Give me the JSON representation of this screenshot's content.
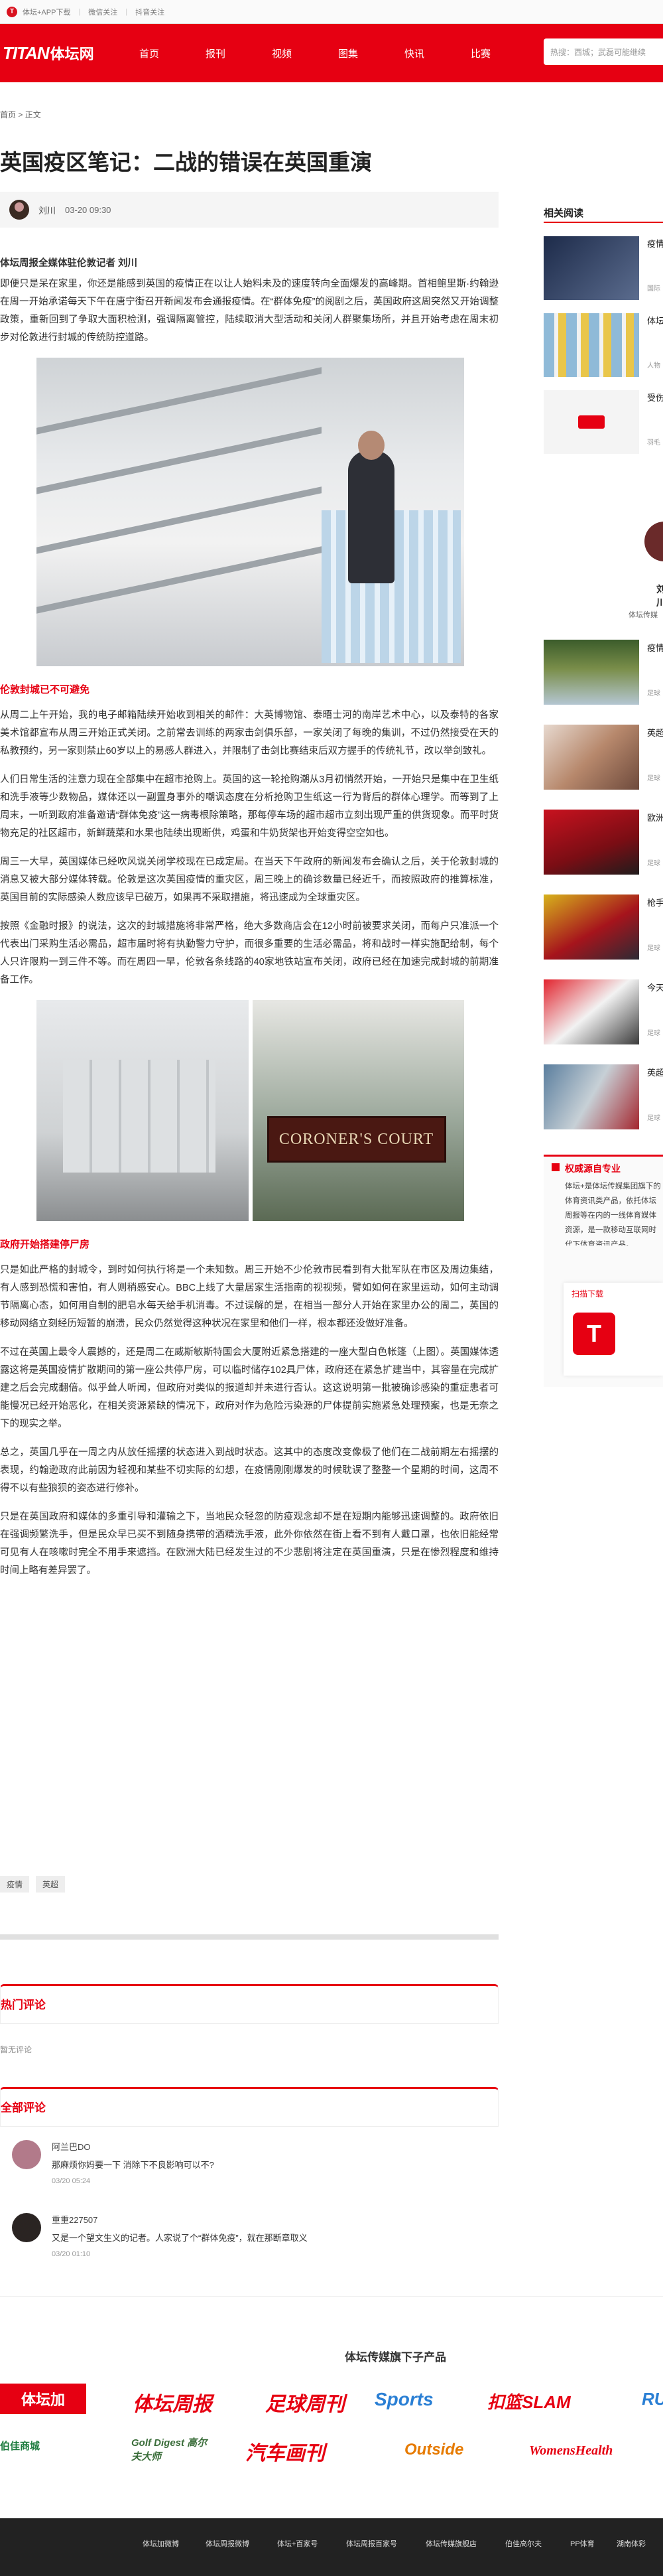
{
  "topbar": {
    "links": [
      "体坛+APP下载",
      "微信关注",
      "抖音关注"
    ]
  },
  "brand": {
    "logo_en": "TITAN",
    "logo_cn": "体坛网"
  },
  "nav": {
    "items": [
      "首页",
      "报刊",
      "视频",
      "图集",
      "快讯",
      "比赛"
    ],
    "search_placeholder": "热搜：西城；武磊可能继续"
  },
  "breadcrumb": {
    "home": "首页",
    "sep": ">",
    "current": "正文"
  },
  "article": {
    "title": "英国疫区笔记：二战的错误在英国重演",
    "author": "刘川",
    "date": "03-20 09:30",
    "lead": "体坛周报全媒体驻伦敦记者 刘川",
    "p1": "即便只是呆在家里，你还是能感到英国的疫情正在以让人始料未及的速度转向全面爆发的高峰期。首相鲍里斯·约翰逊在周一开始承诺每天下午在唐宁街召开新闻发布会通报疫情。在“群体免疫”的阅剧之后，英国政府这周突然又开始调整政策，重新回到了争取大面积检测，强调隔离管控，陆续取消大型活动和关闭人群聚集场所，并且开始考虑在周末初步对伦敦进行封城的传统防控道路。",
    "h1": "伦敦封城已不可避免",
    "p2": "从周二上午开始，我的电子邮箱陆续开始收到相关的邮件：大英博物馆、泰晤士河的南岸艺术中心，以及泰特的各家美术馆都宣布从周三开始正式关闭。之前常去训练的两家击剑俱乐部，一家关闭了每晚的集训，不过仍然接受在天的私教预约，另一家则禁止60岁以上的易感人群进入，并限制了击剑比赛结束后双方握手的传统礼节，改以举剑致礼。",
    "p3": "人们日常生活的注意力现在全部集中在超市抢购上。英国的这一轮抢购潮从3月初悄然开始，一开始只是集中在卫生纸和洗手液等少数物品，媒体还以一副置身事外的嘲讽态度在分析抢购卫生纸这一行为背后的群体心理学。而等到了上周末，一听到政府准备邀请“群体免疫”这一病毒根除策略，那每停车场的超市超市立刻出现严重的供货现象。而平时货物充足的社区超市，新鲜蔬菜和水果也陆续出现断供，鸡蛋和牛奶货架也开始变得空空如也。",
    "p4": "周三一大早，英国媒体已经吹风说关闭学校现在已成定局。在当天下午政府的新闻发布会确认之后，关于伦敦封城的消息又被大部分媒体转载。伦敦是这次英国疫情的重灾区，周三晚上的确诊数量已经近千，而按照政府的推算标准，英国目前的实际感染人数应该早已破万，如果再不采取措施，将迅速成为全球重灾区。",
    "p5": "按照《金融时报》的说法，这次的封城措施将非常严格，绝大多数商店会在12小时前被要求关闭，而每户只准派一个代表出门采购生活必需品，超市届时将有执勤警力守护，而很多重要的生活必需品，将和战时一样实施配给制，每个人只许限购一到三件不等。而在周四一早，伦敦各条线路的40家地铁站宣布关闭，政府已经在加速完成封城的前期准备工作。",
    "h2": "政府开始搭建停尸房",
    "p6": "只是如此严格的封城令，到时如何执行将是一个未知数。周三开始不少伦敦市民看到有大批军队在市区及周边集结，有人感到恐慌和害怕，有人则稍感安心。BBC上线了大量居家生活指南的视视频，譬如如何在家里运动，如何主动调节隔离心态，如何用自制的肥皂水每天给手机消毒。不过误解的是，在相当一部分人开始在家里办公的周二，英国的移动网络立刻经历短暂的崩溃，民众仍然觉得这种状况在家里和他们一样，根本都还没做好准备。",
    "p7": "不过在英国上最令人震撼的，还是周二在威斯敏斯特国会大厦附近紧急搭建的一座大型白色帐篷（上图）。英国媒体透露这将是英国疫情扩散期间的第一座公共停尸房，可以临时储存102具尸体，政府还在紧急扩建当中，其容量在完成扩建之后会完成翻倍。似乎耸人听闻，但政府对类似的报道却并未进行否认。这这说明第一批被确诊感染的重症患者可能慢况已经开始恶化，在相关资源紧缺的情况下，政府对作为危险污染源的尸体提前实施紧急处理预案，也是无奈之下的现实之举。",
    "p8": "总之，英国几乎在一周之内从放任摇摆的状态进入到战时状态。这其中的态度改变像极了他们在二战前期左右摇摆的表现，约翰逊政府此前因为轻视和某些不切实际的幻想，在疫情刚刚爆发的时候耽误了整整一个星期的时间，这周不得不以有些狼狈的姿态进行修补。",
    "p9": "只是在英国政府和媒体的多重引导和灌输之下，当地民众轻忽的防疫观念却不是在短期内能够迅速调整的。政府依旧在强调频繁洗手，但是民众早已买不到随身携带的酒精洗手液，此外你依然在街上看不到有人戴口罩，也依旧能经常可见有人在咳嗽时完全不用手来遮挡。在欧洲大陆已经发生过的不少悲剧将注定在英国重演，只是在惨烈程度和维持时间上略有差异罢了。",
    "img2_sign": "CORONER'S COURT"
  },
  "tags": [
    "疫情",
    "英超"
  ],
  "comments": {
    "hot_title": "热门评论",
    "hot_empty": "暂无评论",
    "all_title": "全部评论",
    "items": [
      {
        "user": "阿兰巴DO",
        "text": "那麻烦你妈要一下 消除下不良影响可以不?",
        "date": "03/20 05:24"
      },
      {
        "user": "重重227507",
        "text": "又是一个望文生义的记者。人家说了个“群体免疫”，就在那断章取义",
        "date": "03/20 01:10"
      }
    ]
  },
  "sidebar": {
    "related_title": "相关阅读",
    "related": [
      {
        "title": "疫情",
        "source": "国际"
      },
      {
        "title": "体坛",
        "source": "人物"
      },
      {
        "title": "受伤",
        "source": "羽毛"
      }
    ],
    "card_name": "刘川",
    "card_sub": "体坛传媒",
    "more": [
      {
        "title": "疫情",
        "source": "足球"
      },
      {
        "title": "英超",
        "source": "足球"
      },
      {
        "title": "欧洲",
        "source": "足球"
      },
      {
        "title": "枪手",
        "source": "足球"
      },
      {
        "title": "今天",
        "source": "足球"
      },
      {
        "title": "英超",
        "source": "足球"
      }
    ],
    "authority_title": "权威源自专业",
    "authority_body": "体坛+是体坛传媒集团旗下的体育资讯类产品，依托体坛周报等在内的一线体育媒体资源，是一款移动互联网时代下体育资讯产品。",
    "qr_label": "扫描下载",
    "qr_icon": "T"
  },
  "family": {
    "title": "体坛传媒旗下子产品",
    "logos": [
      "体坛加",
      "体坛周报",
      "足球周刊",
      "Sports",
      "扣篮SLAM",
      "RU",
      "伯佳商城",
      "Golf Digest 高尔夫大师",
      "汽车画刊",
      "Outside",
      "WomensHealth"
    ]
  },
  "footer": {
    "links": [
      "体坛加微博",
      "体坛周报微博",
      "体坛+百家号",
      "体坛周报百家号",
      "体坛传媒旗舰店",
      "伯佳高尔夫",
      "PP体育",
      "湖南体彩"
    ]
  },
  "colors": {
    "brand_red": "#e60012",
    "footer_bg": "#222222"
  }
}
